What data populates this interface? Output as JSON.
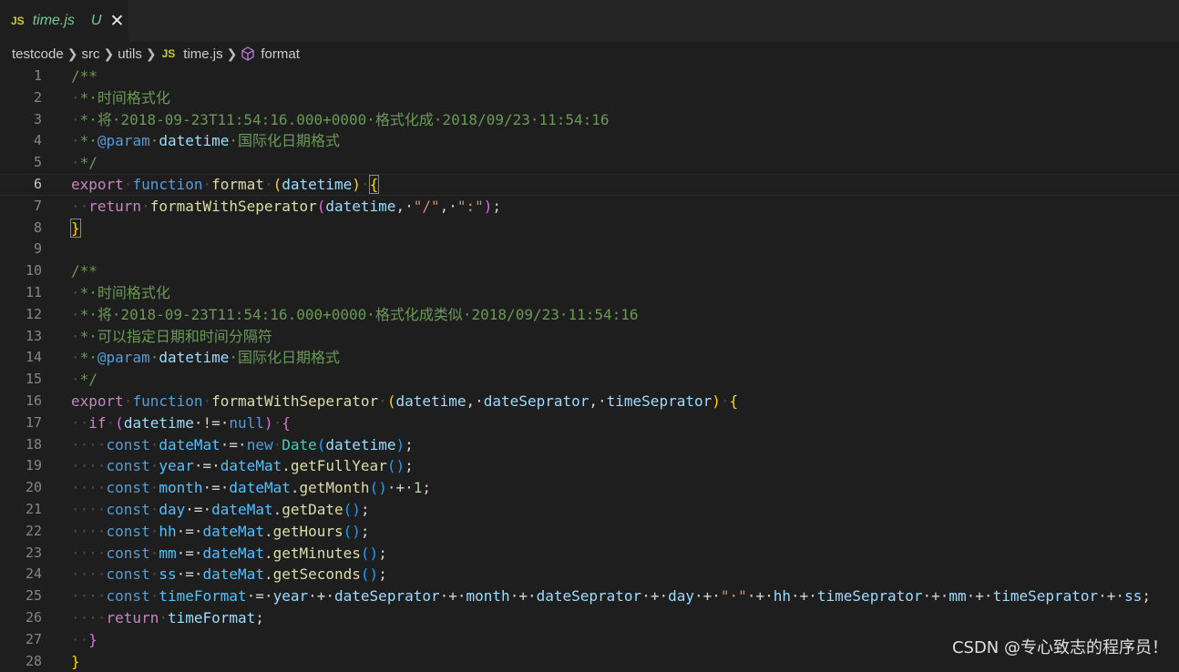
{
  "tab": {
    "badge": "JS",
    "filename": "time.js",
    "status": "U",
    "close": "✕"
  },
  "breadcrumb": {
    "items": [
      "testcode",
      "src",
      "utils",
      "time.js",
      "format"
    ],
    "js_badge": "JS"
  },
  "lines": [
    {
      "n": "1",
      "segs": [
        {
          "t": "/**",
          "c": "c"
        }
      ]
    },
    {
      "n": "2",
      "segs": [
        {
          "t": "·",
          "c": "dot"
        },
        {
          "t": "*·时间格式化",
          "c": "c"
        }
      ]
    },
    {
      "n": "3",
      "segs": [
        {
          "t": "·",
          "c": "dot"
        },
        {
          "t": "*·将·2018-09-23T11:54:16.000+0000·格式化成·2018/09/23·11:54:16",
          "c": "c"
        }
      ]
    },
    {
      "n": "4",
      "segs": [
        {
          "t": "·",
          "c": "dot"
        },
        {
          "t": "*·",
          "c": "c"
        },
        {
          "t": "@param",
          "c": "k"
        },
        {
          "t": "·",
          "c": "c"
        },
        {
          "t": "datetime",
          "c": "p"
        },
        {
          "t": "·国际化日期格式",
          "c": "c"
        }
      ]
    },
    {
      "n": "5",
      "segs": [
        {
          "t": "·",
          "c": "dot"
        },
        {
          "t": "*/",
          "c": "c"
        }
      ]
    },
    {
      "n": "6",
      "active": true,
      "segs": [
        {
          "t": "export",
          "c": "kc"
        },
        {
          "t": "·",
          "c": "dot"
        },
        {
          "t": "function",
          "c": "k"
        },
        {
          "t": "·",
          "c": "dot"
        },
        {
          "t": "format",
          "c": "f"
        },
        {
          "t": "·",
          "c": "dot"
        },
        {
          "t": "(",
          "c": "b1"
        },
        {
          "t": "datetime",
          "c": "p"
        },
        {
          "t": ")",
          "c": "b1"
        },
        {
          "t": "·",
          "c": "dot"
        },
        {
          "t": "{",
          "c": "b1 hl"
        }
      ]
    },
    {
      "n": "7",
      "segs": [
        {
          "t": "··",
          "c": "dot"
        },
        {
          "t": "return",
          "c": "kc"
        },
        {
          "t": "·",
          "c": "dot"
        },
        {
          "t": "formatWithSeperator",
          "c": "f"
        },
        {
          "t": "(",
          "c": "b2"
        },
        {
          "t": "datetime",
          "c": "p"
        },
        {
          "t": ",·",
          "c": "o"
        },
        {
          "t": "\"/\"",
          "c": "s"
        },
        {
          "t": ",·",
          "c": "o"
        },
        {
          "t": "\":\"",
          "c": "s"
        },
        {
          "t": ")",
          "c": "b2"
        },
        {
          "t": ";",
          "c": "o"
        }
      ]
    },
    {
      "n": "8",
      "segs": [
        {
          "t": "}",
          "c": "b1 hl"
        }
      ]
    },
    {
      "n": "9",
      "segs": []
    },
    {
      "n": "10",
      "segs": [
        {
          "t": "/**",
          "c": "c"
        }
      ]
    },
    {
      "n": "11",
      "segs": [
        {
          "t": "·",
          "c": "dot"
        },
        {
          "t": "*·时间格式化",
          "c": "c"
        }
      ]
    },
    {
      "n": "12",
      "segs": [
        {
          "t": "·",
          "c": "dot"
        },
        {
          "t": "*·将·2018-09-23T11:54:16.000+0000·格式化成类似·2018/09/23·11:54:16",
          "c": "c"
        }
      ]
    },
    {
      "n": "13",
      "segs": [
        {
          "t": "·",
          "c": "dot"
        },
        {
          "t": "*·可以指定日期和时间分隔符",
          "c": "c"
        }
      ]
    },
    {
      "n": "14",
      "segs": [
        {
          "t": "·",
          "c": "dot"
        },
        {
          "t": "*·",
          "c": "c"
        },
        {
          "t": "@param",
          "c": "k"
        },
        {
          "t": "·",
          "c": "c"
        },
        {
          "t": "datetime",
          "c": "p"
        },
        {
          "t": "·国际化日期格式",
          "c": "c"
        }
      ]
    },
    {
      "n": "15",
      "segs": [
        {
          "t": "·",
          "c": "dot"
        },
        {
          "t": "*/",
          "c": "c"
        }
      ]
    },
    {
      "n": "16",
      "segs": [
        {
          "t": "export",
          "c": "kc"
        },
        {
          "t": "·",
          "c": "dot"
        },
        {
          "t": "function",
          "c": "k"
        },
        {
          "t": "·",
          "c": "dot"
        },
        {
          "t": "formatWithSeperator",
          "c": "f"
        },
        {
          "t": "·",
          "c": "dot"
        },
        {
          "t": "(",
          "c": "b1"
        },
        {
          "t": "datetime",
          "c": "p"
        },
        {
          "t": ",·",
          "c": "o"
        },
        {
          "t": "dateSeprator",
          "c": "p"
        },
        {
          "t": ",·",
          "c": "o"
        },
        {
          "t": "timeSeprator",
          "c": "p"
        },
        {
          "t": ")",
          "c": "b1"
        },
        {
          "t": "·",
          "c": "dot"
        },
        {
          "t": "{",
          "c": "b1"
        }
      ]
    },
    {
      "n": "17",
      "segs": [
        {
          "t": "··",
          "c": "dot"
        },
        {
          "t": "if",
          "c": "kc"
        },
        {
          "t": "·",
          "c": "dot"
        },
        {
          "t": "(",
          "c": "b2"
        },
        {
          "t": "datetime",
          "c": "p"
        },
        {
          "t": "·!=·",
          "c": "o"
        },
        {
          "t": "null",
          "c": "k"
        },
        {
          "t": ")",
          "c": "b2"
        },
        {
          "t": "·",
          "c": "dot"
        },
        {
          "t": "{",
          "c": "b2"
        }
      ]
    },
    {
      "n": "18",
      "segs": [
        {
          "t": "····",
          "c": "dot"
        },
        {
          "t": "const",
          "c": "k"
        },
        {
          "t": "·",
          "c": "dot"
        },
        {
          "t": "dateMat",
          "c": "v"
        },
        {
          "t": "·=·",
          "c": "o"
        },
        {
          "t": "new",
          "c": "k"
        },
        {
          "t": "·",
          "c": "dot"
        },
        {
          "t": "Date",
          "c": "t"
        },
        {
          "t": "(",
          "c": "b3"
        },
        {
          "t": "datetime",
          "c": "p"
        },
        {
          "t": ")",
          "c": "b3"
        },
        {
          "t": ";",
          "c": "o"
        }
      ]
    },
    {
      "n": "19",
      "segs": [
        {
          "t": "····",
          "c": "dot"
        },
        {
          "t": "const",
          "c": "k"
        },
        {
          "t": "·",
          "c": "dot"
        },
        {
          "t": "year",
          "c": "v"
        },
        {
          "t": "·=·",
          "c": "o"
        },
        {
          "t": "dateMat",
          "c": "v"
        },
        {
          "t": ".",
          "c": "o"
        },
        {
          "t": "getFullYear",
          "c": "f"
        },
        {
          "t": "()",
          "c": "b3"
        },
        {
          "t": ";",
          "c": "o"
        }
      ]
    },
    {
      "n": "20",
      "segs": [
        {
          "t": "····",
          "c": "dot"
        },
        {
          "t": "const",
          "c": "k"
        },
        {
          "t": "·",
          "c": "dot"
        },
        {
          "t": "month",
          "c": "v"
        },
        {
          "t": "·=·",
          "c": "o"
        },
        {
          "t": "dateMat",
          "c": "v"
        },
        {
          "t": ".",
          "c": "o"
        },
        {
          "t": "getMonth",
          "c": "f"
        },
        {
          "t": "()",
          "c": "b3"
        },
        {
          "t": "·+·",
          "c": "o"
        },
        {
          "t": "1",
          "c": "n"
        },
        {
          "t": ";",
          "c": "o"
        }
      ]
    },
    {
      "n": "21",
      "segs": [
        {
          "t": "····",
          "c": "dot"
        },
        {
          "t": "const",
          "c": "k"
        },
        {
          "t": "·",
          "c": "dot"
        },
        {
          "t": "day",
          "c": "v"
        },
        {
          "t": "·=·",
          "c": "o"
        },
        {
          "t": "dateMat",
          "c": "v"
        },
        {
          "t": ".",
          "c": "o"
        },
        {
          "t": "getDate",
          "c": "f"
        },
        {
          "t": "()",
          "c": "b3"
        },
        {
          "t": ";",
          "c": "o"
        }
      ]
    },
    {
      "n": "22",
      "segs": [
        {
          "t": "····",
          "c": "dot"
        },
        {
          "t": "const",
          "c": "k"
        },
        {
          "t": "·",
          "c": "dot"
        },
        {
          "t": "hh",
          "c": "v"
        },
        {
          "t": "·=·",
          "c": "o"
        },
        {
          "t": "dateMat",
          "c": "v"
        },
        {
          "t": ".",
          "c": "o"
        },
        {
          "t": "getHours",
          "c": "f"
        },
        {
          "t": "()",
          "c": "b3"
        },
        {
          "t": ";",
          "c": "o"
        }
      ]
    },
    {
      "n": "23",
      "segs": [
        {
          "t": "····",
          "c": "dot"
        },
        {
          "t": "const",
          "c": "k"
        },
        {
          "t": "·",
          "c": "dot"
        },
        {
          "t": "mm",
          "c": "v"
        },
        {
          "t": "·=·",
          "c": "o"
        },
        {
          "t": "dateMat",
          "c": "v"
        },
        {
          "t": ".",
          "c": "o"
        },
        {
          "t": "getMinutes",
          "c": "f"
        },
        {
          "t": "()",
          "c": "b3"
        },
        {
          "t": ";",
          "c": "o"
        }
      ]
    },
    {
      "n": "24",
      "segs": [
        {
          "t": "····",
          "c": "dot"
        },
        {
          "t": "const",
          "c": "k"
        },
        {
          "t": "·",
          "c": "dot"
        },
        {
          "t": "ss",
          "c": "v"
        },
        {
          "t": "·=·",
          "c": "o"
        },
        {
          "t": "dateMat",
          "c": "v"
        },
        {
          "t": ".",
          "c": "o"
        },
        {
          "t": "getSeconds",
          "c": "f"
        },
        {
          "t": "()",
          "c": "b3"
        },
        {
          "t": ";",
          "c": "o"
        }
      ]
    },
    {
      "n": "25",
      "segs": [
        {
          "t": "····",
          "c": "dot"
        },
        {
          "t": "const",
          "c": "k"
        },
        {
          "t": "·",
          "c": "dot"
        },
        {
          "t": "timeFormat",
          "c": "v"
        },
        {
          "t": "·=·",
          "c": "o"
        },
        {
          "t": "year",
          "c": "p"
        },
        {
          "t": "·+·",
          "c": "o"
        },
        {
          "t": "dateSeprator",
          "c": "p"
        },
        {
          "t": "·+·",
          "c": "o"
        },
        {
          "t": "month",
          "c": "p"
        },
        {
          "t": "·+·",
          "c": "o"
        },
        {
          "t": "dateSeprator",
          "c": "p"
        },
        {
          "t": "·+·",
          "c": "o"
        },
        {
          "t": "day",
          "c": "p"
        },
        {
          "t": "·+·",
          "c": "o"
        },
        {
          "t": "\"·\"",
          "c": "s"
        },
        {
          "t": "·+·",
          "c": "o"
        },
        {
          "t": "hh",
          "c": "p"
        },
        {
          "t": "·+·",
          "c": "o"
        },
        {
          "t": "timeSeprator",
          "c": "p"
        },
        {
          "t": "·+·",
          "c": "o"
        },
        {
          "t": "mm",
          "c": "p"
        },
        {
          "t": "·+·",
          "c": "o"
        },
        {
          "t": "timeSeprator",
          "c": "p"
        },
        {
          "t": "·+·",
          "c": "o"
        },
        {
          "t": "ss",
          "c": "p"
        },
        {
          "t": ";",
          "c": "o"
        }
      ]
    },
    {
      "n": "26",
      "segs": [
        {
          "t": "····",
          "c": "dot"
        },
        {
          "t": "return",
          "c": "kc"
        },
        {
          "t": "·",
          "c": "dot"
        },
        {
          "t": "timeFormat",
          "c": "p"
        },
        {
          "t": ";",
          "c": "o"
        }
      ]
    },
    {
      "n": "27",
      "segs": [
        {
          "t": "··",
          "c": "dot"
        },
        {
          "t": "}",
          "c": "b2"
        }
      ]
    },
    {
      "n": "28",
      "segs": [
        {
          "t": "}",
          "c": "b1"
        }
      ]
    }
  ],
  "watermark": "CSDN @专心致志的程序员！"
}
